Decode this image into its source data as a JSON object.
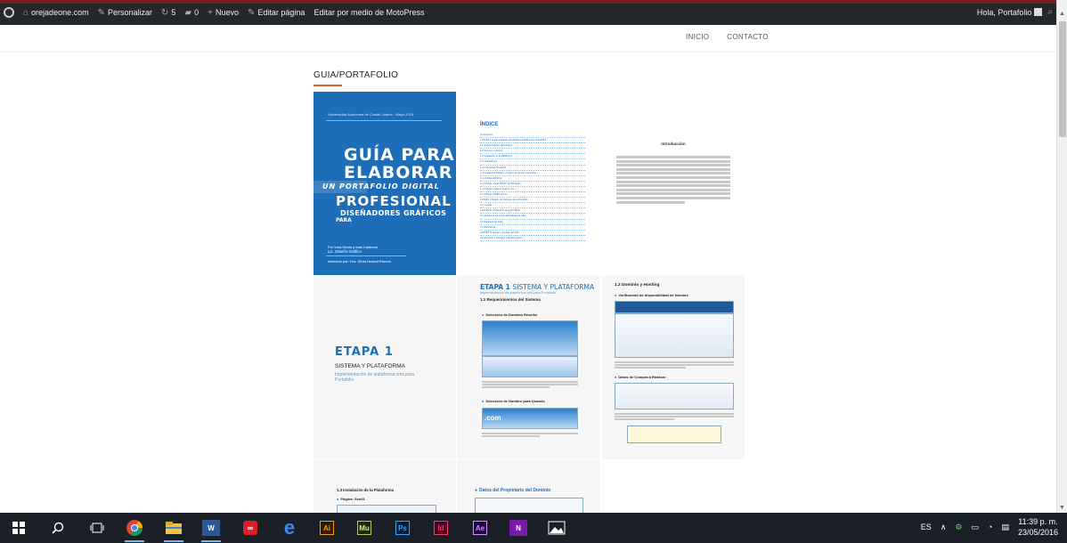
{
  "admin_bar": {
    "site": "orejadeone.com",
    "customize": "Personalizar",
    "updates_count": "5",
    "comments_count": "0",
    "new": "Nuevo",
    "edit_page": "Editar página",
    "edit_motopress": "Editar por medio de MotoPress",
    "greeting": "Hola, Portafolio"
  },
  "nav": {
    "items": [
      "INICIO",
      "CONTACTO"
    ]
  },
  "page": {
    "title": "GUIA/PORTAFOLIO"
  },
  "gallery": {
    "cover": {
      "university": "Universidad Autónoma de Ciudad Juárez · Mayo 2016",
      "line1": "GUÍA PARA",
      "line2": "ELABORAR",
      "line3": "UN PORTAFOLIO DIGITAL",
      "line4": "PROFESIONAL",
      "line4b": "PARA",
      "line5": "DISEÑADORES GRÁFICOS",
      "author_label": "Por Irma Gloria y Irais Calderon",
      "author_role": "Lic. Diseño Gráfico",
      "advisor": "Asesoría por: Dra. Silvia Husted Ramos"
    },
    "index": {
      "title": "ÍNDICE",
      "entries": [
        "Introducción",
        "1 ETAPA 1 Implementación de plataforma CMS para e Portafolio",
        "1.1 Requerimientos del sistema",
        "1.2 Dominio y Hosting",
        "1.3 Instalación de la plataforma",
        "1.3.1 WordPress",
        "1.3.2 Template (Sandard)",
        "1.4 Instalación Widgets y Plugins de función específica",
        "1.4.1 Mobile Portfolio",
        "1.4.2 Plugin: Page Builder by SiteOrigin",
        "1.4.3 Widget: Galeria Gallery Lite",
        "1.4.4 Plugin: WPExcel Lite",
        "2 ETAPA II Diseño de interfase del e-Portafolio",
        "2.1 Layouts",
        "3 ETAPA III Contenidos del e-Portafolio",
        "3.1 Estructura de Contenidos (Mapa de sitio)",
        "3.2 Diagrama de Flujo",
        "3.3 Wireframes",
        "4 ETAPA IV Ajustes y revisión del sitio",
        "4.1 Recursos y consejos (contribuciones)"
      ]
    },
    "intro": {
      "title": "Introducción"
    },
    "etapa": {
      "title": "ETAPA 1",
      "subtitle": "SISTEMA Y PLATAFORMA",
      "desc": "Implementación de plataforma cms para Portafolio"
    },
    "sistema": {
      "title_bold": "ETAPA 1",
      "title_rest": "SISTEMA Y PLATAFORMA",
      "subtitle": "Implementación de plataforma cms para Portafolio",
      "section": "1.1 Requerimientos del Sistema",
      "step1": "Selección de Dominio Reseller",
      "step2": "Selección de Nombre para Usuario",
      "shot_label": ".com"
    },
    "dominio": {
      "title": "1.2 Dominio y Hosting",
      "step1": "Verificación de disponibilidad de Nombre",
      "step2": "Datos de Compra a Realizar"
    },
    "row3a": {
      "title": "1.3 Instalación de la Plataforma",
      "step": "Página: Seo01"
    },
    "row3b": {
      "title": "Datos del Propietario del Dominio"
    }
  },
  "taskbar": {
    "lang": "ES",
    "time": "11:39 p. m.",
    "date": "23/05/2016",
    "apps": [
      "start",
      "search",
      "task-view",
      "chrome",
      "file-explorer",
      "word",
      "creative-cloud",
      "edge",
      "illustrator",
      "muse",
      "photoshop",
      "indesign",
      "after-effects",
      "onenote",
      "photos"
    ]
  }
}
